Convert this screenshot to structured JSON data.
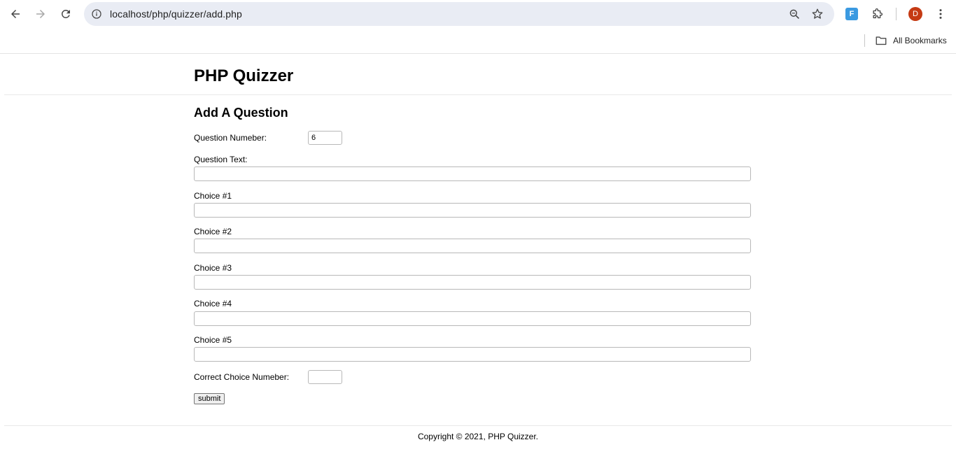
{
  "browser": {
    "url": "localhost/php/quizzer/add.php",
    "avatar_initial": "D",
    "extension_label": "F",
    "bookmarks_label": "All Bookmarks",
    "colors": {
      "omnibox": "#e9ecf4",
      "avatar": "#c53a13",
      "extension": "#3b9ae1"
    }
  },
  "site": {
    "title": "PHP Quizzer",
    "footer": "Copyright © 2021, PHP Quizzer."
  },
  "form": {
    "heading": "Add A Question",
    "question_number_label": "Question Numeber:",
    "question_number_value": "6",
    "question_text_label": "Question Text:",
    "choices": [
      {
        "label": "Choice #1",
        "value": ""
      },
      {
        "label": "Choice #2",
        "value": ""
      },
      {
        "label": "Choice #3",
        "value": ""
      },
      {
        "label": "Choice #4",
        "value": ""
      },
      {
        "label": "Choice #5",
        "value": ""
      }
    ],
    "correct_choice_label": "Correct Choice Numeber:",
    "correct_choice_value": "",
    "submit_label": "submit"
  }
}
